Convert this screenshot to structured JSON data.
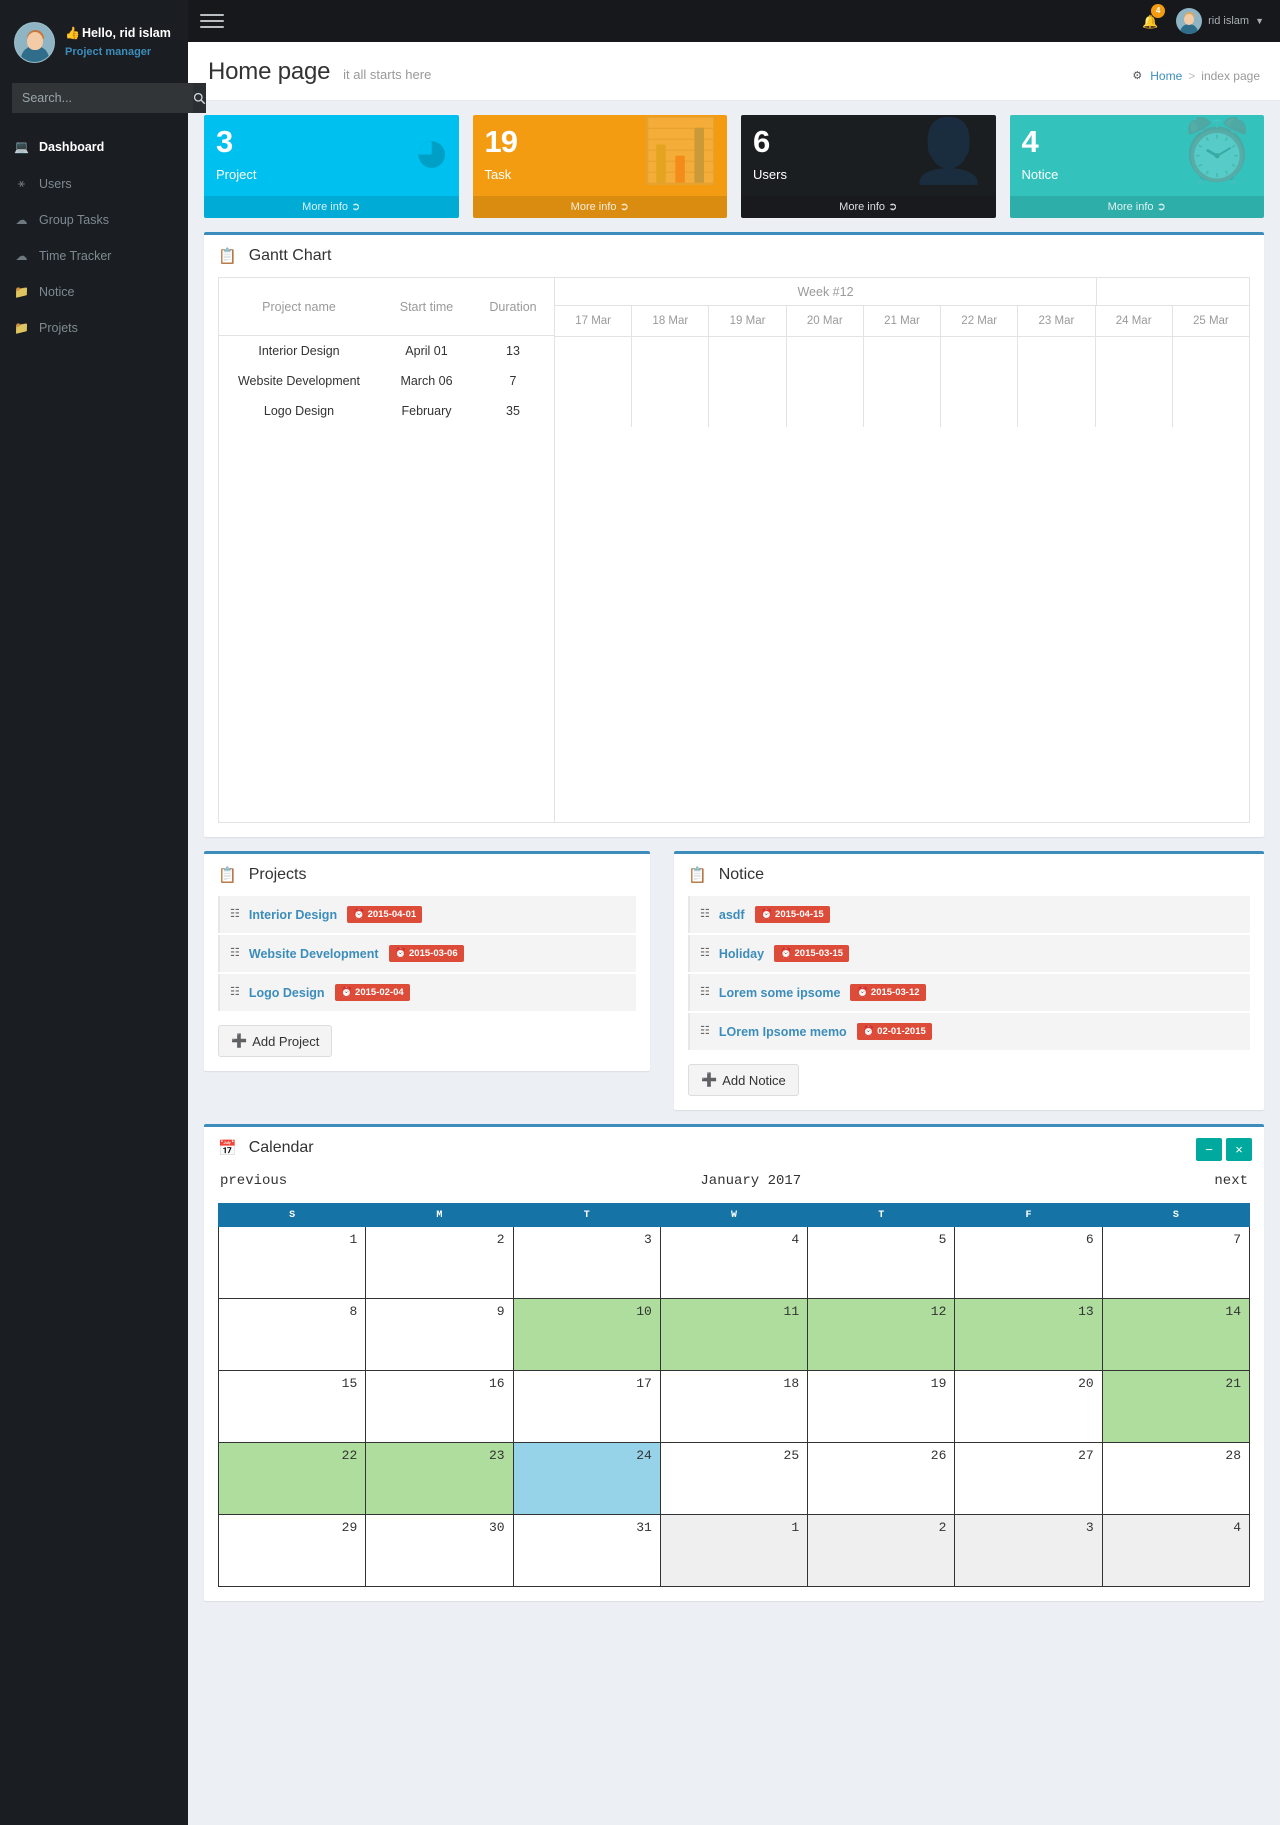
{
  "sidebar": {
    "greeting": "Hello, rid islam",
    "role": "Project manager",
    "search_placeholder": "Search...",
    "search_value": "",
    "items": [
      {
        "label": "Dashboard",
        "icon": "laptop-icon"
      },
      {
        "label": "Users",
        "icon": "users-icon"
      },
      {
        "label": "Group Tasks",
        "icon": "cloud-icon"
      },
      {
        "label": "Time Tracker",
        "icon": "cloud-icon"
      },
      {
        "label": "Notice",
        "icon": "folder-icon"
      },
      {
        "label": "Projets",
        "icon": "folder-icon"
      }
    ]
  },
  "topbar": {
    "notification_count": "4",
    "user_name": "rid islam"
  },
  "header": {
    "title": "Home page",
    "subtitle": "it all starts here",
    "breadcrumb_home": "Home",
    "breadcrumb_sep": ">",
    "breadcrumb_current": "index page"
  },
  "boxes": [
    {
      "number": "3",
      "label": "Project",
      "more": "More info",
      "color": "#00c0ef",
      "icon": "pie-chart-icon"
    },
    {
      "number": "19",
      "label": "Task",
      "more": "More info",
      "color": "#f39c12",
      "icon": "bar-chart-icon"
    },
    {
      "number": "6",
      "label": "Users",
      "more": "More info",
      "color": "#1b1e21",
      "icon": "user-icon"
    },
    {
      "number": "4",
      "label": "Notice",
      "more": "More info",
      "color": "#34c2bd",
      "icon": "alarm-clock-icon"
    }
  ],
  "gantt": {
    "title": "Gantt Chart",
    "columns": [
      "Project name",
      "Start time",
      "Duration"
    ],
    "week_label": "Week #12",
    "days": [
      "17 Mar",
      "18 Mar",
      "19 Mar",
      "20 Mar",
      "21 Mar",
      "22 Mar",
      "23 Mar",
      "24 Mar",
      "25 Mar"
    ],
    "rows": [
      {
        "name": "Interior Design",
        "start": "April 01",
        "duration": "13"
      },
      {
        "name": "Website Development",
        "start": "March 06",
        "duration": "7"
      },
      {
        "name": "Logo Design",
        "start": "February",
        "duration": "35"
      }
    ]
  },
  "projects": {
    "title": "Projects",
    "add_label": "Add Project",
    "items": [
      {
        "name": "Interior Design",
        "date": "2015-04-01"
      },
      {
        "name": "Website Development",
        "date": "2015-03-06"
      },
      {
        "name": "Logo Design",
        "date": "2015-02-04"
      }
    ]
  },
  "notice": {
    "title": "Notice",
    "add_label": "Add Notice",
    "items": [
      {
        "name": "asdf",
        "date": "2015-04-15"
      },
      {
        "name": "Holiday",
        "date": "2015-03-15"
      },
      {
        "name": "Lorem some ipsome",
        "date": "2015-03-12"
      },
      {
        "name": "LOrem Ipsome memo",
        "date": "02-01-2015"
      }
    ]
  },
  "calendar": {
    "title": "Calendar",
    "previous": "previous",
    "next": "next",
    "month_year": "January 2017",
    "weekdays": [
      "S",
      "M",
      "T",
      "W",
      "T",
      "F",
      "S"
    ],
    "weeks": [
      [
        {
          "d": "1",
          "s": "normal"
        },
        {
          "d": "2",
          "s": "normal"
        },
        {
          "d": "3",
          "s": "normal"
        },
        {
          "d": "4",
          "s": "normal"
        },
        {
          "d": "5",
          "s": "normal"
        },
        {
          "d": "6",
          "s": "normal"
        },
        {
          "d": "7",
          "s": "normal"
        }
      ],
      [
        {
          "d": "8",
          "s": "normal"
        },
        {
          "d": "9",
          "s": "normal"
        },
        {
          "d": "10",
          "s": "green"
        },
        {
          "d": "11",
          "s": "green"
        },
        {
          "d": "12",
          "s": "green"
        },
        {
          "d": "13",
          "s": "green"
        },
        {
          "d": "14",
          "s": "green"
        }
      ],
      [
        {
          "d": "15",
          "s": "normal"
        },
        {
          "d": "16",
          "s": "normal"
        },
        {
          "d": "17",
          "s": "normal"
        },
        {
          "d": "18",
          "s": "normal"
        },
        {
          "d": "19",
          "s": "normal"
        },
        {
          "d": "20",
          "s": "normal"
        },
        {
          "d": "21",
          "s": "green"
        }
      ],
      [
        {
          "d": "22",
          "s": "green"
        },
        {
          "d": "23",
          "s": "green"
        },
        {
          "d": "24",
          "s": "blue"
        },
        {
          "d": "25",
          "s": "normal"
        },
        {
          "d": "26",
          "s": "normal"
        },
        {
          "d": "27",
          "s": "normal"
        },
        {
          "d": "28",
          "s": "normal"
        }
      ],
      [
        {
          "d": "29",
          "s": "normal"
        },
        {
          "d": "30",
          "s": "normal"
        },
        {
          "d": "31",
          "s": "normal"
        },
        {
          "d": "1",
          "s": "other"
        },
        {
          "d": "2",
          "s": "other"
        },
        {
          "d": "3",
          "s": "other"
        },
        {
          "d": "4",
          "s": "other"
        }
      ]
    ],
    "tools": {
      "minimize": "−",
      "close": "×"
    }
  }
}
